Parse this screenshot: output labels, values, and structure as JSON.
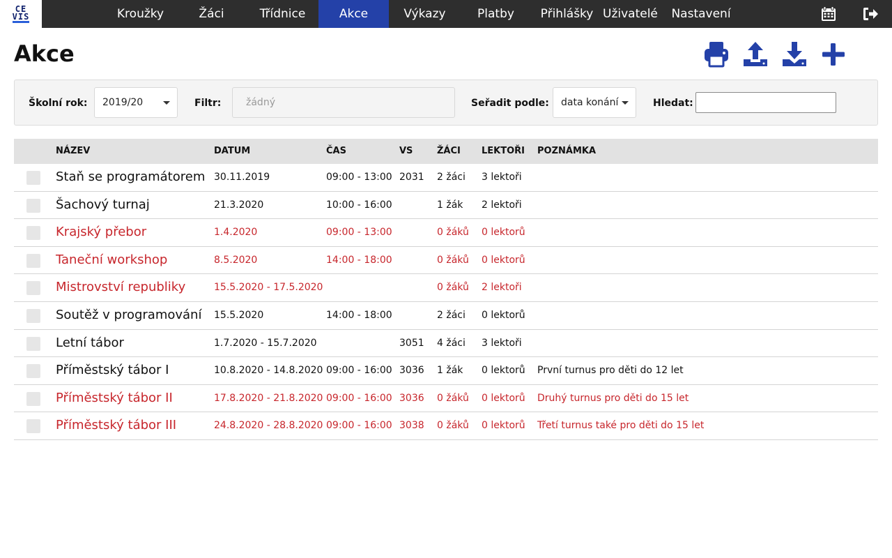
{
  "logo": {
    "line1": "CE",
    "line2": "VIS"
  },
  "nav": {
    "items": [
      {
        "label": "Kroužky",
        "active": false
      },
      {
        "label": "Žáci",
        "active": false
      },
      {
        "label": "Třídnice",
        "active": false
      },
      {
        "label": "Akce",
        "active": true
      },
      {
        "label": "Výkazy",
        "active": false
      },
      {
        "label": "Platby",
        "active": false
      },
      {
        "label": "Přihlášky",
        "active": false
      },
      {
        "label": "Uživatelé",
        "active": false
      },
      {
        "label": "Nastavení",
        "active": false
      }
    ],
    "icons": [
      "calendar-icon",
      "logout-icon"
    ]
  },
  "page": {
    "title": "Akce"
  },
  "actions": [
    "print-icon",
    "upload-icon",
    "download-icon",
    "plus-icon"
  ],
  "colors": {
    "accent": "#2441a8",
    "nav_bg": "#2e2e2e",
    "inactive_text": "#c7262c"
  },
  "filter": {
    "school_year_label": "Školní rok:",
    "school_year_value": "2019/20",
    "filter_label": "Filtr:",
    "filter_placeholder": "žádný",
    "sort_label": "Seřadit podle:",
    "sort_value": "data konání",
    "search_label": "Hledat:",
    "search_value": ""
  },
  "table": {
    "columns": {
      "name": "NÁZEV",
      "date": "DATUM",
      "time": "ČAS",
      "vs": "VS",
      "students": "ŽÁCI",
      "lecturers": "LEKTOŘI",
      "note": "POZNÁMKA"
    },
    "rows": [
      {
        "name": "Staň se programátorem",
        "date": "30.11.2019",
        "time": "09:00 - 13:00",
        "vs": "2031",
        "students": "2 žáci",
        "lecturers": "3 lektoři",
        "note": "",
        "inactive": false
      },
      {
        "name": "Šachový turnaj",
        "date": "21.3.2020",
        "time": "10:00 - 16:00",
        "vs": "",
        "students": "1 žák",
        "lecturers": "2 lektoři",
        "note": "",
        "inactive": false
      },
      {
        "name": "Krajský přebor",
        "date": "1.4.2020",
        "time": "09:00 - 13:00",
        "vs": "",
        "students": "0 žáků",
        "lecturers": "0 lektorů",
        "note": "",
        "inactive": true
      },
      {
        "name": "Taneční workshop",
        "date": "8.5.2020",
        "time": "14:00 - 18:00",
        "vs": "",
        "students": "0 žáků",
        "lecturers": "0 lektorů",
        "note": "",
        "inactive": true
      },
      {
        "name": "Mistrovství republiky",
        "date": "15.5.2020 - 17.5.2020",
        "time": "",
        "vs": "",
        "students": "0 žáků",
        "lecturers": "2 lektoři",
        "note": "",
        "inactive": true
      },
      {
        "name": "Soutěž v programování",
        "date": "15.5.2020",
        "time": "14:00 - 18:00",
        "vs": "",
        "students": "2 žáci",
        "lecturers": "0 lektorů",
        "note": "",
        "inactive": false
      },
      {
        "name": "Letní tábor",
        "date": "1.7.2020 - 15.7.2020",
        "time": "",
        "vs": "3051",
        "students": "4 žáci",
        "lecturers": "3 lektoři",
        "note": "",
        "inactive": false
      },
      {
        "name": "Příměstský tábor I",
        "date": "10.8.2020 - 14.8.2020",
        "time": "09:00 - 16:00",
        "vs": "3036",
        "students": "1 žák",
        "lecturers": "0 lektorů",
        "note": "První turnus pro děti do 12 let",
        "inactive": false
      },
      {
        "name": "Příměstský tábor II",
        "date": "17.8.2020 - 21.8.2020",
        "time": "09:00 - 16:00",
        "vs": "3036",
        "students": "0 žáků",
        "lecturers": "0 lektorů",
        "note": "Druhý turnus pro děti do 15 let",
        "inactive": true
      },
      {
        "name": "Příměstský tábor III",
        "date": "24.8.2020 - 28.8.2020",
        "time": "09:00 - 16:00",
        "vs": "3038",
        "students": "0 žáků",
        "lecturers": "0 lektorů",
        "note": "Třetí turnus také pro děti do 15 let",
        "inactive": true
      }
    ]
  }
}
